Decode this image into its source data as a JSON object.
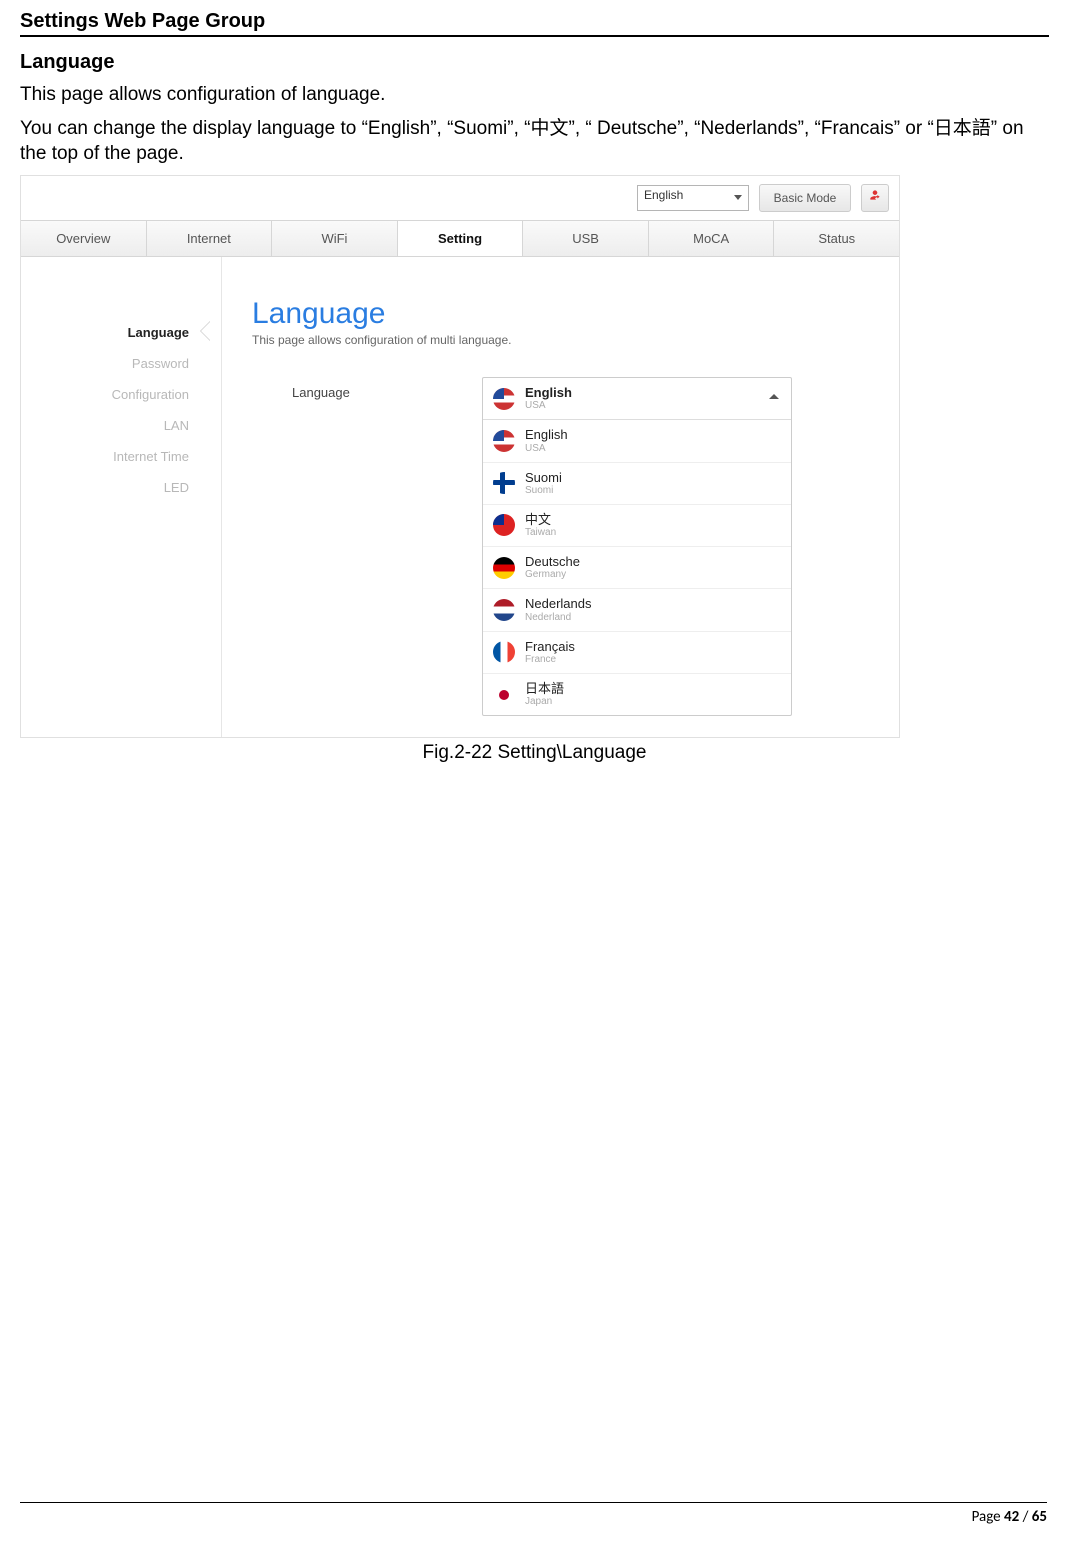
{
  "doc": {
    "title": "Settings Web Page Group",
    "section": "Language",
    "p1": "This page allows configuration of language.",
    "p2": "You can change the display language to “English”, “Suomi”, “中文”, “ Deutsche”, “Nederlands”, “Francais” or “日本語” on the top of the page.",
    "caption": "Fig.2-22 Setting\\Language",
    "footer_prefix": "Page ",
    "footer_page": "42",
    "footer_sep": " / ",
    "footer_total": "65"
  },
  "shot": {
    "top_lang": "English",
    "mode_btn": "Basic Mode",
    "tabs": [
      "Overview",
      "Internet",
      "WiFi",
      "Setting",
      "USB",
      "MoCA",
      "Status"
    ],
    "active_tab": 3,
    "sidebar": [
      "Language",
      "Password",
      "Configuration",
      "LAN",
      "Internet Time",
      "LED"
    ],
    "active_side": 0,
    "content_title": "Language",
    "content_sub": "This page allows configuration of multi language.",
    "field_label": "Language",
    "selected": {
      "name": "English",
      "sub": "USA"
    },
    "options": [
      {
        "name": "English",
        "sub": "USA",
        "flag": "flag-usa"
      },
      {
        "name": "Suomi",
        "sub": "Suomi",
        "flag": "flag-fin"
      },
      {
        "name": "中文",
        "sub": "Taiwan",
        "flag": "flag-twn"
      },
      {
        "name": "Deutsche",
        "sub": "Germany",
        "flag": "flag-ger"
      },
      {
        "name": "Nederlands",
        "sub": "Nederland",
        "flag": "flag-ned"
      },
      {
        "name": "Français",
        "sub": "France",
        "flag": "flag-fra"
      },
      {
        "name": "日本語",
        "sub": "Japan",
        "flag": "flag-jpn"
      }
    ]
  }
}
